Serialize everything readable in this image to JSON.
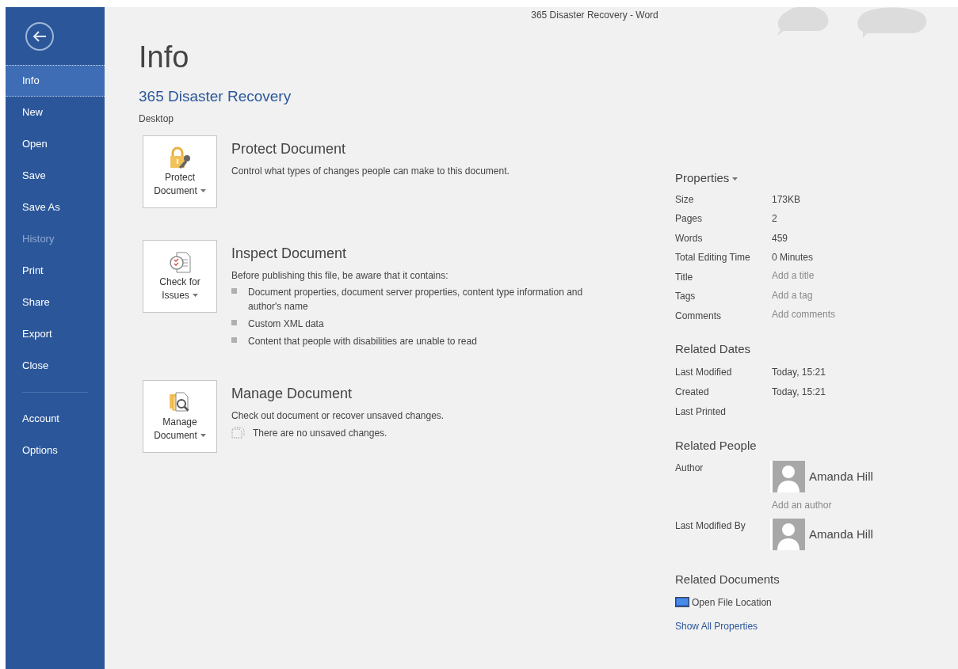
{
  "window": {
    "title": "365 Disaster Recovery - Word"
  },
  "sidebar": {
    "groups": [
      [
        {
          "label": "Info",
          "selected": true,
          "disabled": false
        },
        {
          "label": "New",
          "selected": false,
          "disabled": false
        },
        {
          "label": "Open",
          "selected": false,
          "disabled": false
        },
        {
          "label": "Save",
          "selected": false,
          "disabled": false
        },
        {
          "label": "Save As",
          "selected": false,
          "disabled": false
        },
        {
          "label": "History",
          "selected": false,
          "disabled": true
        },
        {
          "label": "Print",
          "selected": false,
          "disabled": false
        },
        {
          "label": "Share",
          "selected": false,
          "disabled": false
        },
        {
          "label": "Export",
          "selected": false,
          "disabled": false
        },
        {
          "label": "Close",
          "selected": false,
          "disabled": false
        }
      ],
      [
        {
          "label": "Account",
          "selected": false,
          "disabled": false
        },
        {
          "label": "Options",
          "selected": false,
          "disabled": false
        }
      ]
    ]
  },
  "page_title": "Info",
  "document": {
    "name": "365 Disaster Recovery",
    "location": "Desktop"
  },
  "actions": [
    {
      "kind": "protect",
      "button_lines": [
        "Protect",
        "Document"
      ],
      "title": "Protect Document",
      "description": "Control what types of changes people can make to this document."
    },
    {
      "kind": "inspect",
      "button_lines": [
        "Check for",
        "Issues"
      ],
      "title": "Inspect Document",
      "description": "Before publishing this file, be aware that it contains:",
      "bullets": [
        "Document properties, document server properties, content type information and author's name",
        "Custom XML data",
        "Content that people with disabilities are unable to read"
      ]
    },
    {
      "kind": "manage",
      "button_lines": [
        "Manage",
        "Document"
      ],
      "title": "Manage Document",
      "description": "Check out document or recover unsaved changes.",
      "note": "There are no unsaved changes."
    }
  ],
  "properties": {
    "title": "Properties",
    "rows": [
      {
        "label": "Size",
        "value": "173KB"
      },
      {
        "label": "Pages",
        "value": "2"
      },
      {
        "label": "Words",
        "value": "459"
      },
      {
        "label": "Total Editing Time",
        "value": "0 Minutes"
      },
      {
        "label": "Title",
        "placeholder": "Add a title"
      },
      {
        "label": "Tags",
        "placeholder": "Add a tag"
      },
      {
        "label": "Comments",
        "placeholder": "Add comments"
      }
    ]
  },
  "related_dates": {
    "title": "Related Dates",
    "rows": [
      {
        "label": "Last Modified",
        "value": "Today, 15:21"
      },
      {
        "label": "Created",
        "value": "Today, 15:21"
      },
      {
        "label": "Last Printed"
      }
    ]
  },
  "related_people": {
    "title": "Related People",
    "rows": [
      {
        "label": "Author",
        "name": "Amanda Hill",
        "add_author": {
          "placeholder": "Add an author"
        }
      },
      {
        "label": "Last Modified By",
        "name": "Amanda Hill"
      }
    ]
  },
  "related_documents": {
    "title": "Related Documents",
    "link": "Open File Location"
  },
  "show_all_link": "Show All Properties"
}
